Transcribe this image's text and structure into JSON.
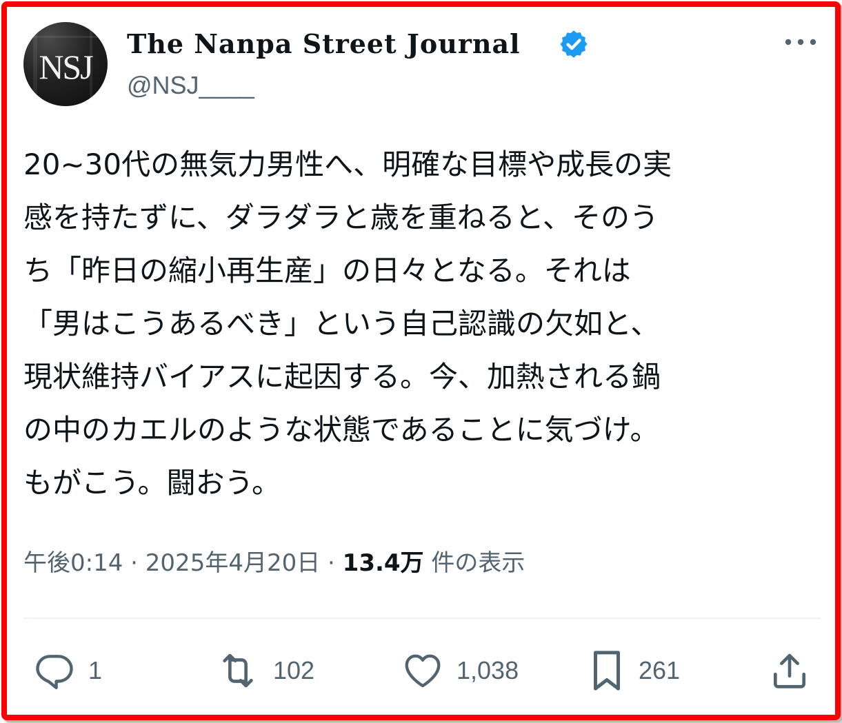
{
  "author": {
    "display_name": "The Nanpa Street Journal",
    "handle": "@NSJ____",
    "avatar_text": "NSJ",
    "verified": true,
    "verified_color": "#1d9bf0"
  },
  "tweet": {
    "lines": [
      "20~30代の無気力男性へ、明確な目標や成長の実",
      "感を持たずに、ダラダラと歳を重ねると、そのう",
      "ち「昨日の縮小再生産」の日々となる。それは",
      "「男はこうあるべき」という自己認識の欠如と、",
      "現状維持バイアスに起因する。今、加熱される鍋",
      "の中のカエルのような状態であることに気づけ。",
      "もがこう。闘おう。"
    ]
  },
  "meta": {
    "time": "午後0:14",
    "separator": "·",
    "date": "2025年4月20日",
    "views_count": "13.4万",
    "views_label": "件の表示"
  },
  "actions": {
    "reply_count": "1",
    "repost_count": "102",
    "like_count": "1,038",
    "bookmark_count": "261"
  },
  "icons": {
    "more": "more-icon",
    "reply": "reply-icon",
    "repost": "repost-icon",
    "like": "like-icon",
    "bookmark": "bookmark-icon",
    "share": "share-icon"
  },
  "colors": {
    "frame_border": "#ff0000",
    "text_primary": "#0f1419",
    "text_secondary": "#536471"
  }
}
